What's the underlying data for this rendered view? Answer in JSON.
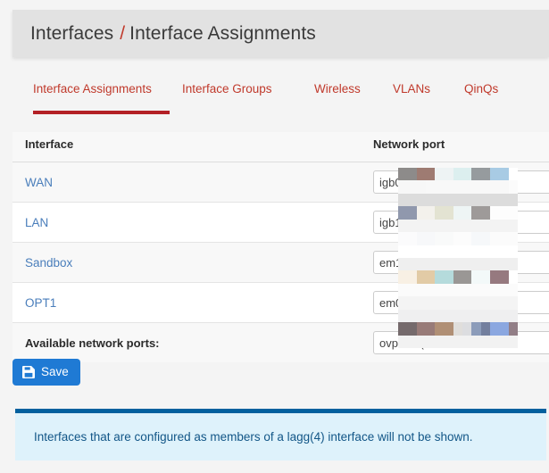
{
  "header": {
    "breadcrumb_parent": "Interfaces",
    "breadcrumb_separator": "/",
    "breadcrumb_current": "Interface Assignments"
  },
  "tabs": [
    {
      "label": "Interface Assignments",
      "active": true
    },
    {
      "label": "Interface Groups",
      "active": false
    },
    {
      "label": "Wireless",
      "active": false
    },
    {
      "label": "VLANs",
      "active": false
    },
    {
      "label": "QinQs",
      "active": false
    }
  ],
  "table": {
    "columns": {
      "interface": "Interface",
      "network_port": "Network port"
    },
    "rows": [
      {
        "interface": "WAN",
        "port": "igb0 (a0"
      },
      {
        "interface": "LAN",
        "port": "igb1 (a0"
      },
      {
        "interface": "Sandbox",
        "port": "em1 (00"
      },
      {
        "interface": "OPT1",
        "port": "em0 (00"
      }
    ],
    "footer": {
      "label": "Available network ports:",
      "port": "ovpns1 ("
    }
  },
  "toolbar": {
    "save_label": "Save",
    "save_icon": "floppy-save-icon"
  },
  "alert": {
    "text": "Interfaces that are configured as members of a lagg(4) interface will not be shown."
  },
  "colors": {
    "page_background": "#f4f4f4",
    "breadcrumb_background": "#e2e2e2",
    "tab_text": "#c0392b",
    "tab_active_underline": "#b32025",
    "link_blue": "#4a7ebb",
    "save_button": "#1f7ad4",
    "alert_background": "#def2fb",
    "alert_border": "#02609e",
    "alert_text": "#125687"
  }
}
